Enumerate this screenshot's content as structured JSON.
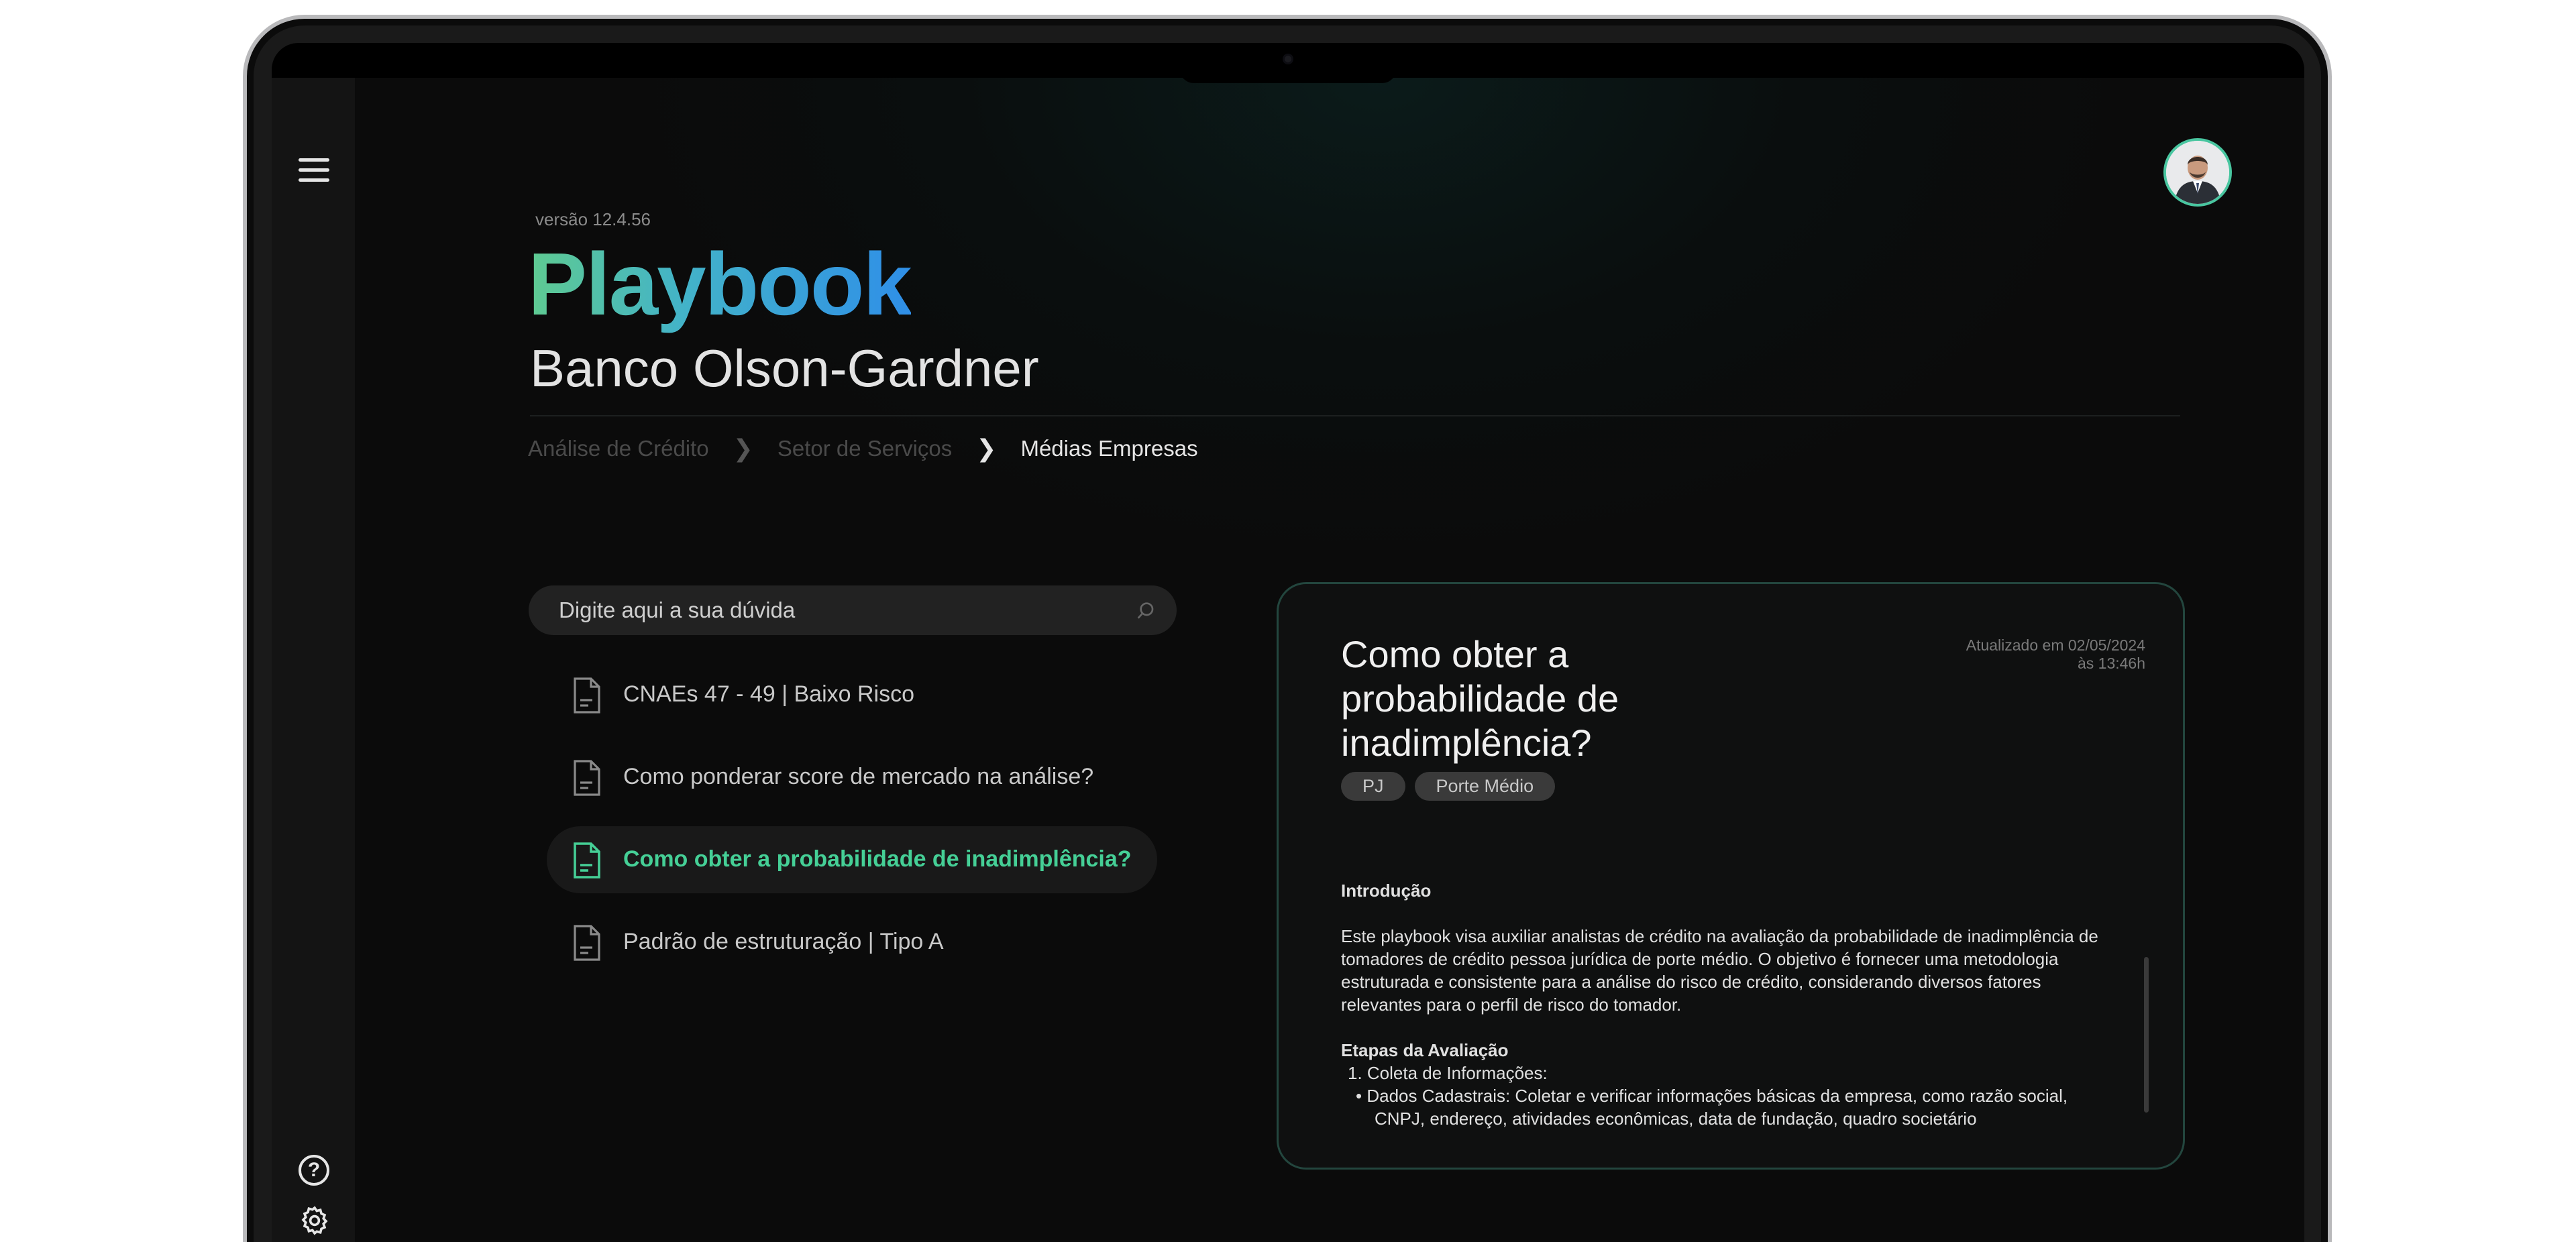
{
  "header": {
    "version": "versão 12.4.56",
    "title": "Playbook",
    "subtitle": "Banco Olson-Gardner"
  },
  "breadcrumb": [
    "Análise de Crédito",
    "Setor de Serviços",
    "Médias Empresas"
  ],
  "search": {
    "placeholder": "Digite aqui a sua dúvida"
  },
  "list": [
    {
      "label": "CNAEs 47 - 49 | Baixo Risco",
      "active": false
    },
    {
      "label": "Como ponderar score de mercado na análise?",
      "active": false
    },
    {
      "label": "Como obter a probabilidade de inadimplência?",
      "active": true
    },
    {
      "label": "Padrão de estruturação | Tipo A",
      "active": false
    }
  ],
  "card": {
    "title": "Como obter a probabilidade de inadimplência?",
    "updated_line1": "Atualizado em 02/05/2024",
    "updated_line2": "às 13:46h",
    "tags": [
      "PJ",
      "Porte Médio"
    ],
    "section1_title": "Introdução",
    "section1_text": "Este playbook visa auxiliar analistas de crédito na avaliação da probabilidade de inadimplência de tomadores de crédito pessoa jurídica de porte médio. O objetivo é fornecer uma metodologia estruturada e consistente para a análise do risco de crédito, considerando diversos fatores relevantes para o perfil de risco do tomador.",
    "section2_title": "Etapas da Avaliação",
    "step1": "1. Coleta de Informações:",
    "bullet1": "• Dados Cadastrais: Coletar e verificar informações básicas da empresa, como razão social, CNPJ, endereço, atividades econômicas, data de fundação, quadro societário"
  },
  "colors": {
    "accent": "#45cf96",
    "title_gradient_start": "#5fcb91",
    "title_gradient_end": "#2f8fe8",
    "card_border": "#23463e"
  },
  "icons": {
    "menu": "hamburger-menu-icon",
    "help": "question-circle-icon",
    "settings": "gear-icon",
    "search": "search-icon",
    "document": "document-icon"
  }
}
